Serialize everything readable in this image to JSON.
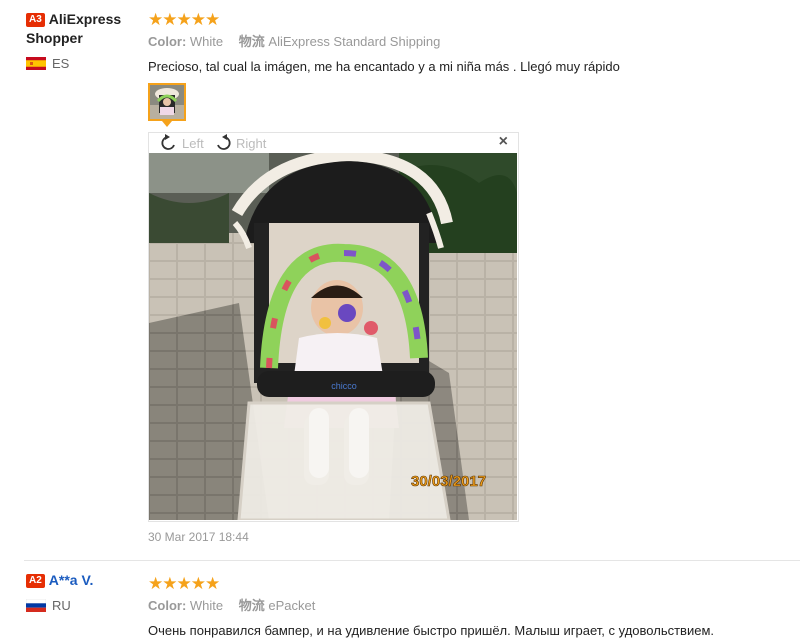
{
  "reviews": [
    {
      "level": "A3",
      "name": "AliExpress Shopper",
      "country": "ES",
      "stars": "★★★★★",
      "color_label": "Color:",
      "color_value": "White",
      "shipping_label": "物流",
      "shipping_value": "AliExpress Standard Shipping",
      "text": "Precioso, tal cual la imágen, me ha encantado y a mi niña más . Llegó muy rápido",
      "viewer": {
        "rotate_left": "Left",
        "rotate_right": "Right",
        "close": "×",
        "photo_stamp": "30/03/2017"
      },
      "date": "30 Mar 2017 18:44"
    },
    {
      "level": "A2",
      "name": "A**a V.",
      "country": "RU",
      "stars": "★★★★★",
      "color_label": "Color:",
      "color_value": "White",
      "shipping_label": "物流",
      "shipping_value": "ePacket",
      "text": "Очень понравился бампер, и на удивление быстро пришёл. Малыш играет, с удовольствием."
    }
  ],
  "colors": {
    "star": "#f5a21b",
    "badge": "#e62e04",
    "thumb_border": "#f5a21b"
  }
}
